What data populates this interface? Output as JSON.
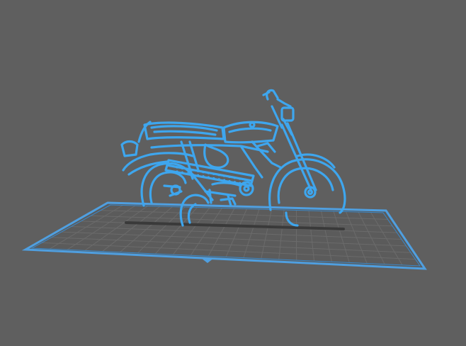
{
  "viewport": {
    "background": "#5f5f5f"
  },
  "build_plate": {
    "fill": "#5b5b5b",
    "grid_color": "#6a6a6a",
    "border_color": "#4f9fe0",
    "shadow_color": "#3e3e3e"
  },
  "model": {
    "icon": "motorcycle-outline-icon",
    "stroke": "#3ea6ee",
    "highlight": "#7cc9ff"
  }
}
